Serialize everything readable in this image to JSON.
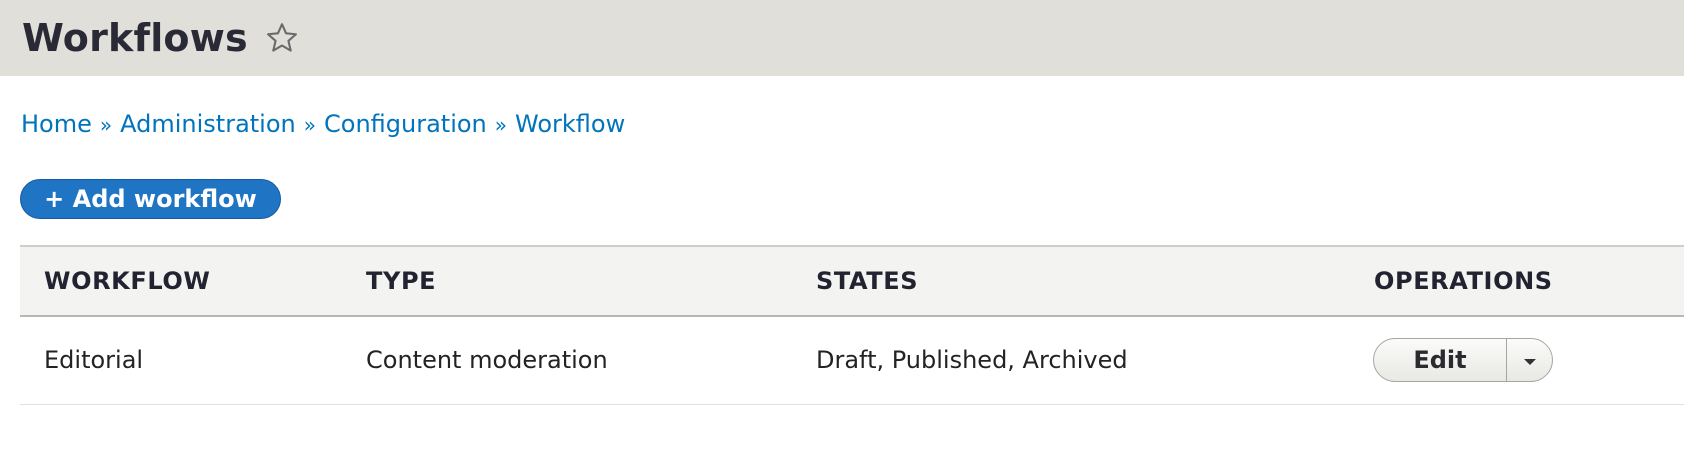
{
  "header": {
    "title": "Workflows",
    "star_icon": "star-outline-icon"
  },
  "breadcrumb": {
    "items": [
      "Home",
      "Administration",
      "Configuration",
      "Workflow"
    ],
    "separator": "»"
  },
  "actions": {
    "add_label": "+ Add workflow"
  },
  "table": {
    "columns": [
      "WORKFLOW",
      "TYPE",
      "STATES",
      "OPERATIONS"
    ],
    "rows": [
      {
        "workflow": "Editorial",
        "type": "Content moderation",
        "states": "Draft, Published, Archived",
        "operation_label": "Edit"
      }
    ]
  },
  "colors": {
    "header_bg": "#e0dfd9",
    "link": "#0074bd",
    "primary_button": "#1f75c3"
  }
}
